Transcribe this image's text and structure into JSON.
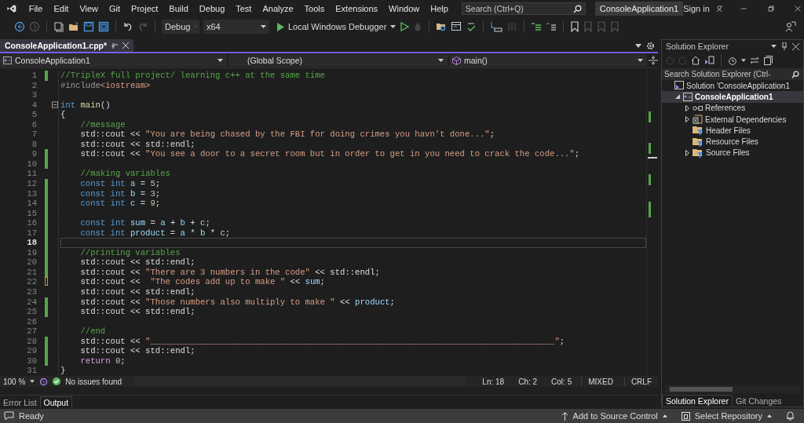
{
  "menu_bar": {
    "items": [
      "File",
      "Edit",
      "View",
      "Git",
      "Project",
      "Build",
      "Debug",
      "Test",
      "Analyze",
      "Tools",
      "Extensions",
      "Window",
      "Help"
    ],
    "search": {
      "placeholder": "Search (Ctrl+Q)"
    },
    "solution_name": "ConsoleApplication1",
    "sign_in": "Sign in"
  },
  "toolbar": {
    "configuration": "Debug",
    "platform": "x64",
    "run_target": "Local Windows Debugger"
  },
  "document_tabs": [
    {
      "label": "ConsoleApplication1.cpp*",
      "selected": true
    }
  ],
  "navigation_bar": {
    "project": "ConsoleApplication1",
    "scope": "(Global Scope)",
    "member": "main()"
  },
  "editor": {
    "lines": [
      {
        "number": "1",
        "modified": true,
        "saved": true,
        "fold": false,
        "current": false,
        "tokens": [
          {
            "kind": "comment",
            "text": "//TripleX full project/ learning c++ at the same time"
          }
        ]
      },
      {
        "number": "2",
        "modified": false,
        "fold": false,
        "current": false,
        "tokens": [
          {
            "kind": "preprocessor",
            "text": "#include"
          },
          {
            "kind": "string",
            "text": "<iostream>"
          }
        ]
      },
      {
        "number": "3",
        "modified": false,
        "fold": false,
        "current": false
      },
      {
        "number": "4",
        "modified": false,
        "fold": true,
        "current": false,
        "tokens": [
          {
            "kind": "keyword",
            "text": "int"
          },
          {
            "kind": "function",
            "text": " main"
          },
          {
            "kind": "plain",
            "text": "()"
          }
        ]
      },
      {
        "number": "5",
        "modified": false,
        "fold": false,
        "current": false,
        "tokens": [
          {
            "kind": "plain",
            "text": "{"
          }
        ]
      },
      {
        "number": "6",
        "modified": false,
        "fold": false,
        "current": false,
        "tokens": [
          {
            "kind": "comment",
            "text": "    //message"
          }
        ]
      },
      {
        "number": "7",
        "modified": false,
        "fold": false,
        "current": false,
        "tokens": [
          {
            "kind": "plain",
            "text": "    std::cout << "
          },
          {
            "kind": "string",
            "text": "\"You are being chased by the FBI for doing crimes you havn't done...\""
          },
          {
            "kind": "plain",
            "text": ";"
          }
        ]
      },
      {
        "number": "8",
        "modified": false,
        "fold": false,
        "current": false,
        "tokens": [
          {
            "kind": "plain",
            "text": "    std::cout << std::endl;"
          }
        ]
      },
      {
        "number": "9",
        "modified": true,
        "saved": true,
        "fold": false,
        "current": false,
        "tokens": [
          {
            "kind": "plain",
            "text": "    std::cout << "
          },
          {
            "kind": "string",
            "text": "\"You see a door to a secret room but in order to get in you need to crack the code...\""
          },
          {
            "kind": "plain",
            "text": ";"
          }
        ]
      },
      {
        "number": "10",
        "modified": true,
        "saved": true,
        "fold": false,
        "current": false
      },
      {
        "number": "11",
        "modified": false,
        "fold": false,
        "current": false,
        "tokens": [
          {
            "kind": "comment",
            "text": "    //making variables"
          }
        ]
      },
      {
        "number": "12",
        "modified": true,
        "saved": true,
        "fold": false,
        "current": false,
        "tokens": [
          {
            "kind": "keyword",
            "text": "    const int"
          },
          {
            "kind": "variable",
            "text": " a"
          },
          {
            "kind": "plain",
            "text": " = "
          },
          {
            "kind": "number",
            "text": "5"
          },
          {
            "kind": "plain",
            "text": ";"
          }
        ]
      },
      {
        "number": "13",
        "modified": true,
        "saved": true,
        "fold": false,
        "current": false,
        "tokens": [
          {
            "kind": "keyword",
            "text": "    const int"
          },
          {
            "kind": "variable",
            "text": " b"
          },
          {
            "kind": "plain",
            "text": " = "
          },
          {
            "kind": "number",
            "text": "3"
          },
          {
            "kind": "plain",
            "text": ";"
          }
        ]
      },
      {
        "number": "14",
        "modified": true,
        "saved": true,
        "fold": false,
        "current": false,
        "tokens": [
          {
            "kind": "keyword",
            "text": "    const int"
          },
          {
            "kind": "variable",
            "text": " c"
          },
          {
            "kind": "plain",
            "text": " = "
          },
          {
            "kind": "number",
            "text": "9"
          },
          {
            "kind": "plain",
            "text": ";"
          }
        ]
      },
      {
        "number": "15",
        "modified": true,
        "saved": true,
        "fold": false,
        "current": false
      },
      {
        "number": "16",
        "modified": true,
        "saved": true,
        "fold": false,
        "current": false,
        "tokens": [
          {
            "kind": "keyword",
            "text": "    const int"
          },
          {
            "kind": "variable",
            "text": " sum"
          },
          {
            "kind": "plain",
            "text": " = "
          },
          {
            "kind": "variable",
            "text": "a"
          },
          {
            "kind": "plain",
            "text": " + "
          },
          {
            "kind": "variable",
            "text": "b"
          },
          {
            "kind": "plain",
            "text": " + "
          },
          {
            "kind": "variable",
            "text": "c"
          },
          {
            "kind": "plain",
            "text": ";"
          }
        ]
      },
      {
        "number": "17",
        "modified": true,
        "saved": true,
        "fold": false,
        "current": false,
        "tokens": [
          {
            "kind": "keyword",
            "text": "    const int"
          },
          {
            "kind": "variable",
            "text": " product"
          },
          {
            "kind": "plain",
            "text": " = "
          },
          {
            "kind": "variable",
            "text": "a"
          },
          {
            "kind": "plain",
            "text": " * "
          },
          {
            "kind": "variable",
            "text": "b"
          },
          {
            "kind": "plain",
            "text": " * "
          },
          {
            "kind": "variable",
            "text": "c"
          },
          {
            "kind": "plain",
            "text": ";"
          }
        ]
      },
      {
        "number": "18",
        "modified": true,
        "saved": true,
        "fold": false,
        "current": true
      },
      {
        "number": "19",
        "modified": true,
        "saved": true,
        "fold": false,
        "current": false,
        "tokens": [
          {
            "kind": "comment",
            "text": "    //printing variables"
          }
        ]
      },
      {
        "number": "20",
        "modified": true,
        "saved": true,
        "fold": false,
        "current": false,
        "tokens": [
          {
            "kind": "plain",
            "text": "    std::cout << std::endl;"
          }
        ]
      },
      {
        "number": "21",
        "modified": true,
        "saved": true,
        "fold": false,
        "current": false,
        "tokens": [
          {
            "kind": "plain",
            "text": "    std::cout << "
          },
          {
            "kind": "string",
            "text": "\"There are 3 numbers in the code\""
          },
          {
            "kind": "plain",
            "text": " << std::endl;"
          }
        ]
      },
      {
        "number": "22",
        "modified": true,
        "saved": false,
        "fold": false,
        "current": false,
        "tokens": [
          {
            "kind": "plain",
            "text": "    std::cout <<  "
          },
          {
            "kind": "string",
            "text": "\"The codes add up to make \""
          },
          {
            "kind": "plain",
            "text": " << "
          },
          {
            "kind": "variable",
            "text": "sum"
          },
          {
            "kind": "plain",
            "text": ";"
          }
        ]
      },
      {
        "number": "23",
        "modified": false,
        "fold": false,
        "current": false,
        "tokens": [
          {
            "kind": "plain",
            "text": "    std::cout << std::endl;"
          }
        ]
      },
      {
        "number": "24",
        "modified": true,
        "saved": true,
        "fold": false,
        "current": false,
        "tokens": [
          {
            "kind": "plain",
            "text": "    std::cout << "
          },
          {
            "kind": "string",
            "text": "\"Those numbers also multiply to make \""
          },
          {
            "kind": "plain",
            "text": " << "
          },
          {
            "kind": "variable",
            "text": "product"
          },
          {
            "kind": "plain",
            "text": ";"
          }
        ]
      },
      {
        "number": "25",
        "modified": true,
        "saved": true,
        "fold": false,
        "current": false,
        "tokens": [
          {
            "kind": "plain",
            "text": "    std::cout << std::endl;"
          }
        ]
      },
      {
        "number": "26",
        "modified": false,
        "fold": false,
        "current": false
      },
      {
        "number": "27",
        "modified": false,
        "fold": false,
        "current": false,
        "tokens": [
          {
            "kind": "comment",
            "text": "    //end"
          }
        ]
      },
      {
        "number": "28",
        "modified": true,
        "saved": true,
        "fold": false,
        "current": false,
        "tokens": [
          {
            "kind": "plain",
            "text": "    std::cout << "
          },
          {
            "kind": "string",
            "text": "\"_________________________________________________________________________________\""
          },
          {
            "kind": "plain",
            "text": ";"
          }
        ]
      },
      {
        "number": "29",
        "modified": true,
        "saved": true,
        "fold": false,
        "current": false,
        "tokens": [
          {
            "kind": "plain",
            "text": "    std::cout << std::endl;"
          }
        ]
      },
      {
        "number": "30",
        "modified": true,
        "saved": true,
        "fold": false,
        "current": false,
        "tokens": [
          {
            "kind": "control",
            "text": "    return"
          },
          {
            "kind": "number",
            "text": " 0"
          },
          {
            "kind": "plain",
            "text": ";"
          }
        ]
      },
      {
        "number": "31",
        "modified": false,
        "fold": false,
        "current": false,
        "tokens": [
          {
            "kind": "plain",
            "text": "}"
          }
        ]
      }
    ],
    "zoom": "100 %",
    "issues": "No issues found",
    "line": "Ln: 18",
    "char": "Ch: 2",
    "column": "Col: 5",
    "whitespace": "MIXED",
    "line_endings": "CRLF"
  },
  "bottom_tabs": [
    {
      "label": "Error List",
      "selected": false
    },
    {
      "label": "Output",
      "selected": true
    }
  ],
  "solution_explorer": {
    "title": "Solution Explorer",
    "search": {
      "placeholder": "Search Solution Explorer (Ctrl-"
    },
    "tree": [
      {
        "label": "Solution 'ConsoleApplication1",
        "kind": "solution",
        "expandable": false,
        "selected": false,
        "children": [
          {
            "label": "ConsoleApplication1",
            "kind": "project",
            "expandable": true,
            "expanded": true,
            "selected": true,
            "children": [
              {
                "label": "References",
                "kind": "references",
                "expandable": true,
                "expanded": false,
                "selected": false
              },
              {
                "label": "External Dependencies",
                "kind": "dependencies",
                "expandable": true,
                "expanded": false,
                "selected": false
              },
              {
                "label": "Header Files",
                "kind": "folder",
                "expandable": false,
                "selected": false
              },
              {
                "label": "Resource Files",
                "kind": "folder",
                "expandable": false,
                "selected": false
              },
              {
                "label": "Source Files",
                "kind": "folder",
                "expandable": true,
                "expanded": false,
                "selected": false
              }
            ]
          }
        ]
      }
    ],
    "tabs": [
      {
        "label": "Solution Explorer",
        "selected": true
      },
      {
        "label": "Git Changes",
        "selected": false
      }
    ]
  },
  "status_bar": {
    "text": "Ready",
    "source_control": "Add to Source Control",
    "repository": "Select Repository"
  }
}
